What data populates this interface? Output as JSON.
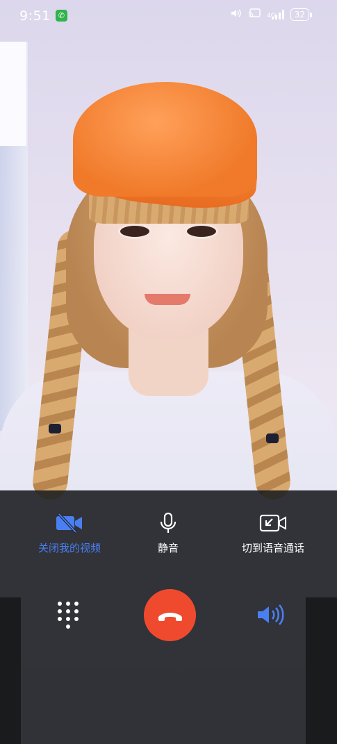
{
  "status_bar": {
    "time": "9:51",
    "network_label": "4G",
    "battery": "32"
  },
  "controls": {
    "turn_off_video": {
      "label": "关闭我的视频",
      "icon": "video-off-icon",
      "active": true
    },
    "mute": {
      "label": "静音",
      "icon": "microphone-icon"
    },
    "switch_to_voice": {
      "label": "切到语音通话",
      "icon": "switch-to-voice-icon"
    }
  },
  "bottom_bar": {
    "keypad_icon": "dialpad-icon",
    "hangup_icon": "hangup-icon",
    "speaker_icon": "speaker-icon"
  },
  "colors": {
    "accent_blue": "#4a7ff2",
    "hangup_red": "#f04a2e",
    "call_indicator_green": "#2fb34b"
  }
}
